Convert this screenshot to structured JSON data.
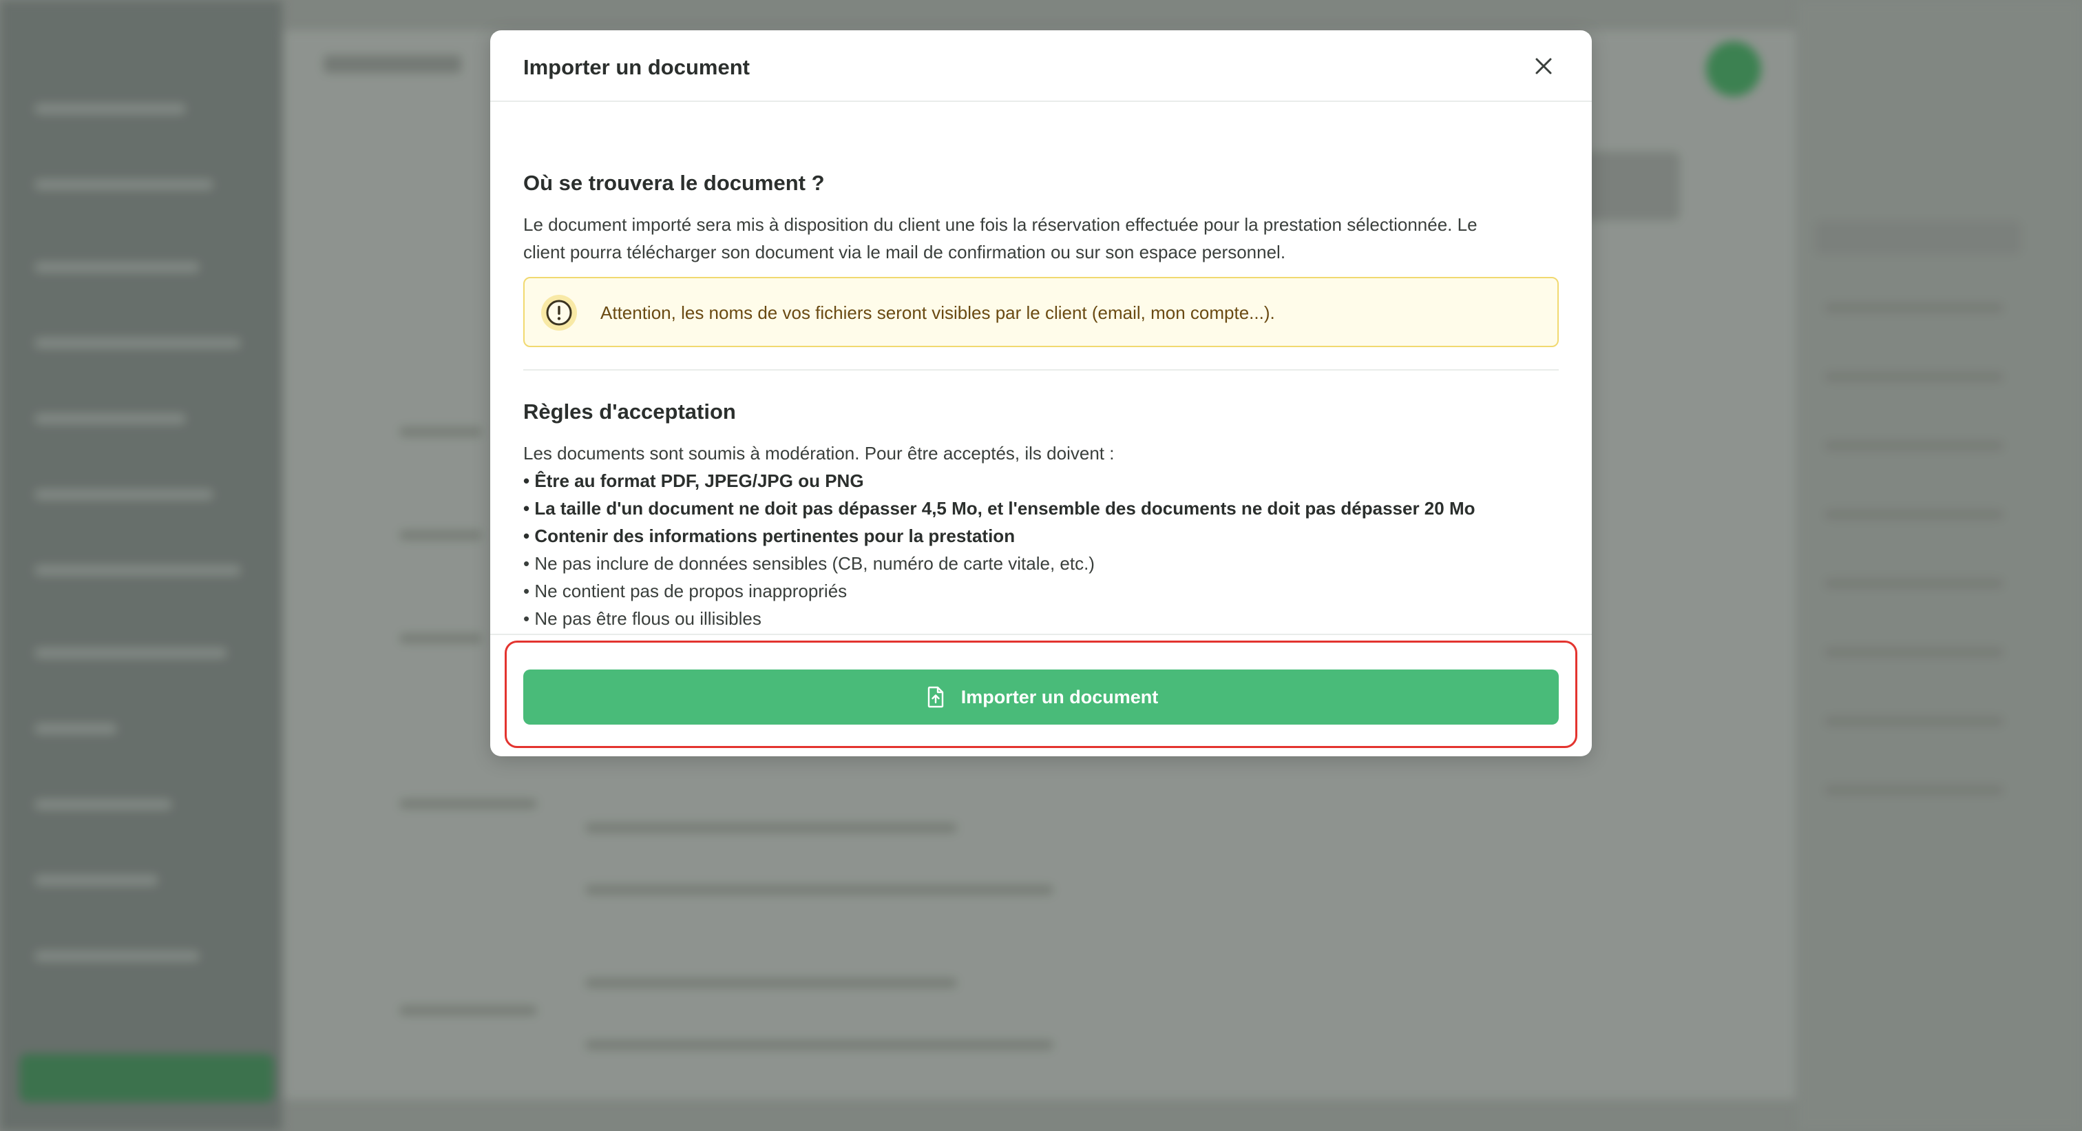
{
  "modal": {
    "title": "Importer un document",
    "close_icon": "close-icon",
    "location_section": {
      "title": "Où se trouvera le document ?",
      "description_line1": "Le document importé sera mis à disposition du client une fois la réservation effectuée pour la prestation sélectionnée. Le",
      "description_line2": "client pourra télécharger son document via le mail de confirmation ou sur son espace personnel."
    },
    "warning": {
      "icon": "exclamation-circle-icon",
      "text": "Attention, les noms de vos fichiers seront visibles par le client (email, mon compte...)."
    },
    "rules_section": {
      "title": "Règles d'acceptation",
      "intro": "Les documents sont soumis à modération. Pour être acceptés, ils doivent :",
      "rules": [
        {
          "text": "• Être au format PDF, JPEG/JPG ou PNG",
          "bold": true
        },
        {
          "text": "• La taille d'un document ne doit pas dépasser 4,5 Mo, et l'ensemble des documents ne doit pas dépasser 20 Mo",
          "bold": true
        },
        {
          "text": "• Contenir des informations pertinentes pour la prestation",
          "bold": true
        },
        {
          "text": "• Ne pas inclure de données sensibles (CB, numéro de carte vitale, etc.)",
          "bold": false
        },
        {
          "text": "• Ne contient pas de propos inappropriés",
          "bold": false
        },
        {
          "text": "• Ne pas être flous ou illisibles",
          "bold": false
        }
      ]
    },
    "import_button": {
      "label": "Importer un document",
      "icon": "file-upload-icon"
    }
  },
  "colors": {
    "primary_green": "#49bb79",
    "warning_bg": "#fffcea",
    "warning_border": "#f1d970",
    "warning_text": "#6a4a12",
    "highlight_red": "#e3342f"
  }
}
